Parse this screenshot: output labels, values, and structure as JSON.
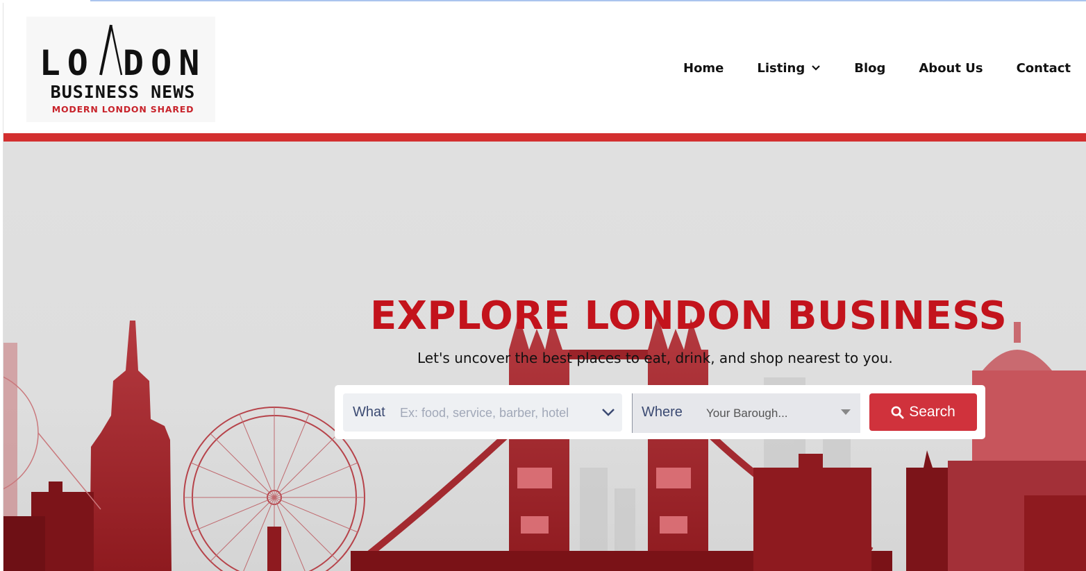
{
  "logo": {
    "top": "LO DON",
    "middle": "BUSINESS NEWS",
    "tagline": "MODERN LONDON SHARED"
  },
  "nav": {
    "items": [
      {
        "label": "Home"
      },
      {
        "label": "Listing",
        "icon": "chevron-down-icon"
      },
      {
        "label": "Blog"
      },
      {
        "label": "About Us"
      },
      {
        "label": "Contact"
      }
    ]
  },
  "hero": {
    "title": "EXPLORE LONDON BUSINESS",
    "subtitle": "Let's uncover the best places to eat, drink, and shop nearest to you."
  },
  "search": {
    "what_label": "What",
    "what_placeholder": "Ex: food, service, barber, hotel",
    "where_label": "Where",
    "where_value": "Your Barough...",
    "button_label": "Search",
    "button_icon": "search-icon"
  },
  "colors": {
    "brand_red": "#d32f2f",
    "title_red": "#c3131c",
    "button_red": "#d0323c"
  }
}
